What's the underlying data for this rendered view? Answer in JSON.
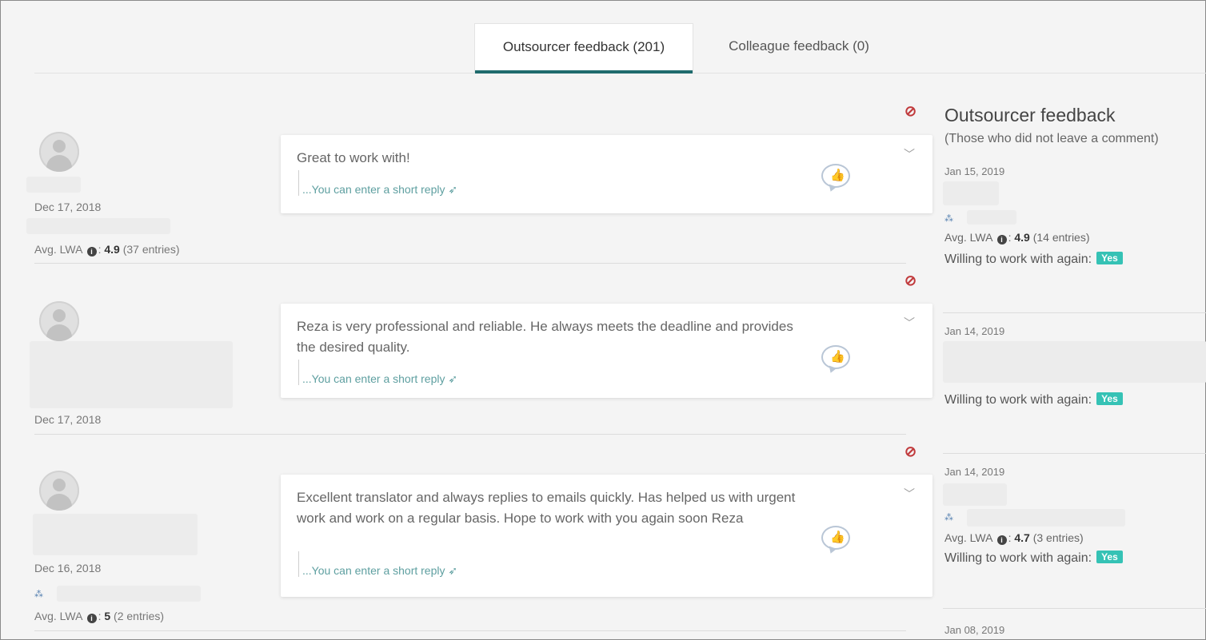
{
  "tabs": [
    {
      "label": "Outsourcer feedback (201)",
      "active": true
    },
    {
      "label": "Colleague feedback (0)",
      "active": false
    }
  ],
  "common": {
    "reply_placeholder": "...You can enter a short reply",
    "lwa_label": "Avg. LWA",
    "willing_label": "Willing to work with again:",
    "yes_label": "Yes"
  },
  "feedback": [
    {
      "date": "Dec 17, 2018",
      "comment": "Great to work with!",
      "lwa_value": "4.9",
      "lwa_entries": "(37 entries)"
    },
    {
      "date": "Dec 17, 2018",
      "comment": "Reza is very professional and reliable. He always meets the deadline and provides the desired quality."
    },
    {
      "date": "Dec 16, 2018",
      "comment": "Excellent translator and always replies to emails quickly. Has helped us with urgent work and work on a regular basis. Hope to work with you again soon Reza",
      "lwa_value": "5",
      "lwa_entries": "(2 entries)"
    }
  ],
  "side": {
    "title": "Outsourcer feedback",
    "subtitle": "(Those who did not leave a comment)",
    "items": [
      {
        "date": "Jan 15, 2019",
        "lwa_value": "4.9",
        "lwa_entries": "(14 entries)"
      },
      {
        "date": "Jan 14, 2019"
      },
      {
        "date": "Jan 14, 2019",
        "lwa_value": "4.7",
        "lwa_entries": "(3 entries)"
      },
      {
        "date": "Jan 08, 2019"
      }
    ]
  },
  "colors": {
    "accent": "#1f6b6d",
    "yes_badge": "#35c2b5",
    "hide_icon": "#c0393b"
  },
  "icons": [
    "eye-slash-icon",
    "thumbs-up-icon",
    "chevron-down-icon",
    "paper-plane-icon",
    "info-icon",
    "group-icon",
    "avatar-placeholder"
  ]
}
